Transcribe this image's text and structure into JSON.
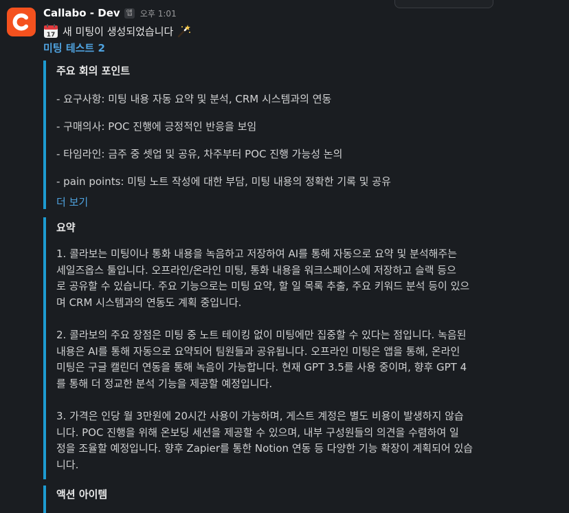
{
  "message": {
    "app_name": "Callabo - Dev",
    "app_badge": "앱",
    "timestamp": "오후 1:01",
    "announcement": "새 미팅이 생성되었습니다",
    "emoji_before": "calendar-emoji",
    "emoji_after": "magic-wand-emoji",
    "meeting_title": "미팅 테스트 2"
  },
  "key_points": {
    "heading": "주요 회의 포인트",
    "items": [
      "- 요구사항: 미팅 내용 자동 요약 및 분석, CRM 시스템과의 연동",
      "- 구매의사: POC 진행에 긍정적인 반응을 보임",
      "- 타임라인: 금주 중 셋업 및 공유, 차주부터 POC 진행 가능성 논의",
      "- pain points: 미팅 노트 작성에 대한 부담, 미팅 내용의 정확한 기록 및 공유"
    ],
    "show_more": "더 보기"
  },
  "summary": {
    "heading": "요약",
    "paragraphs": [
      "1. 콜라보는 미팅이나 통화 내용을 녹음하고 저장하여 AI를 통해 자동으로 요약 및 분석해주는\n세일즈옵스 툴입니다. 오프라인/온라인 미팅, 통화 내용을 워크스페이스에 저장하고 슬랙 등으\n로 공유할 수 있습니다. 주요 기능으로는 미팅 요약, 할 일 목록 추출, 주요 키워드 분석 등이 있으\n며 CRM 시스템과의 연동도 계획 중입니다.",
      "2. 콜라보의 주요 장점은 미팅 중 노트 테이킹 없이 미팅에만 집중할 수 있다는 점입니다. 녹음된\n내용은 AI를 통해 자동으로 요약되어 팀원들과 공유됩니다. 오프라인 미팅은 앱을 통해, 온라인\n미팅은 구글 캘린더 연동을 통해 녹음이 가능합니다. 현재 GPT 3.5를 사용 중이며, 향후 GPT 4\n를 통해 더 정교한 분석 기능을 제공할 예정입니다.",
      "3. 가격은 인당 월 3만원에 20시간 사용이 가능하며, 게스트 계정은 별도 비용이 발생하지 않습\n니다. POC 진행을 위해 온보딩 세션을 제공할 수 있으며, 내부 구성원들의 의견을 수렴하여 일\n정을 조율할 예정입니다. 향후 Zapier를 통한 Notion 연동 등 다양한 기능 확장이 계획되어 있습\n니다."
    ]
  },
  "action_items": {
    "heading": "액션 아이템"
  },
  "colors": {
    "background": "#1a1d21",
    "accent_bar": "#1d9bd1",
    "link": "#4fa3e0",
    "avatar": "#f4511e"
  }
}
